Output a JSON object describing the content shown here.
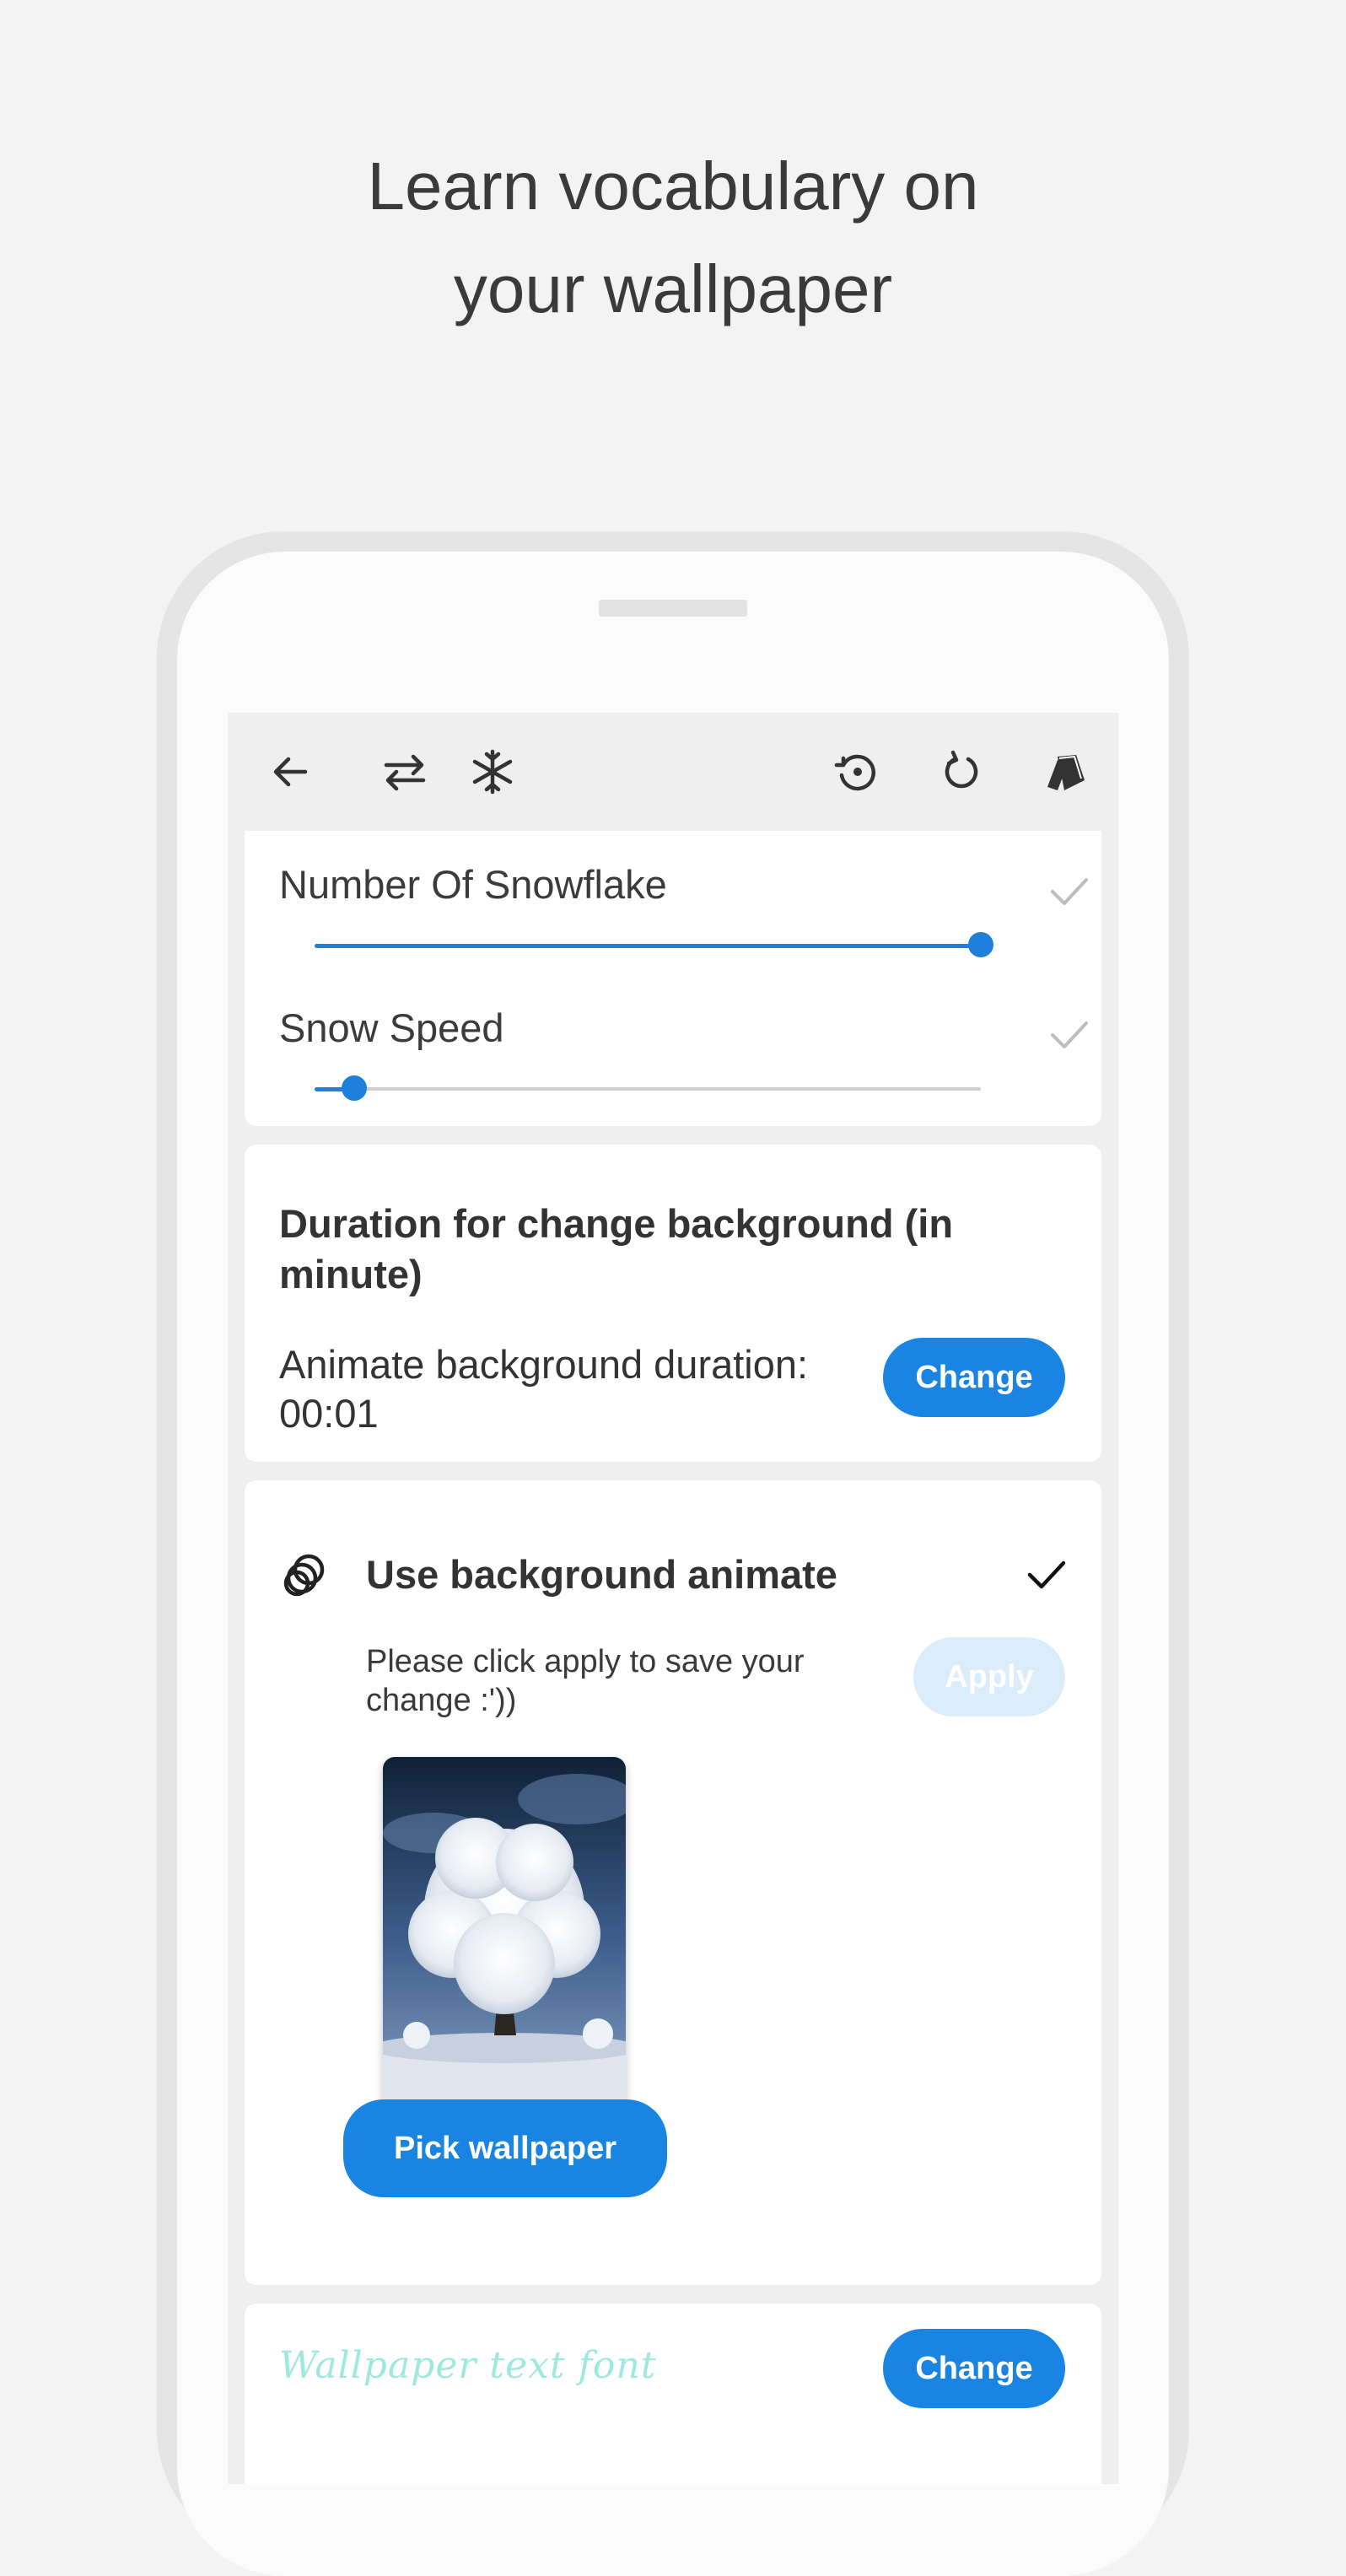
{
  "headline": {
    "line1": "Learn vocabulary on",
    "line2": "your wallpaper"
  },
  "toolbar": {
    "icons": [
      "back-arrow-icon",
      "swap-icon",
      "snowflake-icon",
      "history-icon",
      "refresh-icon",
      "cards-icon"
    ]
  },
  "snow": {
    "number_label": "Number Of Snowflake",
    "number_value": 1.0,
    "speed_label": "Snow Speed",
    "speed_value": 0.06
  },
  "duration": {
    "title": "Duration for change background (in minute)",
    "text_line1": "Animate background duration:",
    "text_line2": "00:01",
    "button": "Change"
  },
  "animate": {
    "title": "Use background animate",
    "hint": "Please click apply to save your change :'))",
    "apply_button": "Apply",
    "pick_button": "Pick wallpaper"
  },
  "font": {
    "sample": "Wallpaper text font",
    "button": "Change"
  },
  "colors": {
    "accent": "#1a84e3",
    "accent_disabled": "#dbecfb",
    "font_sample": "#9fe8df"
  }
}
